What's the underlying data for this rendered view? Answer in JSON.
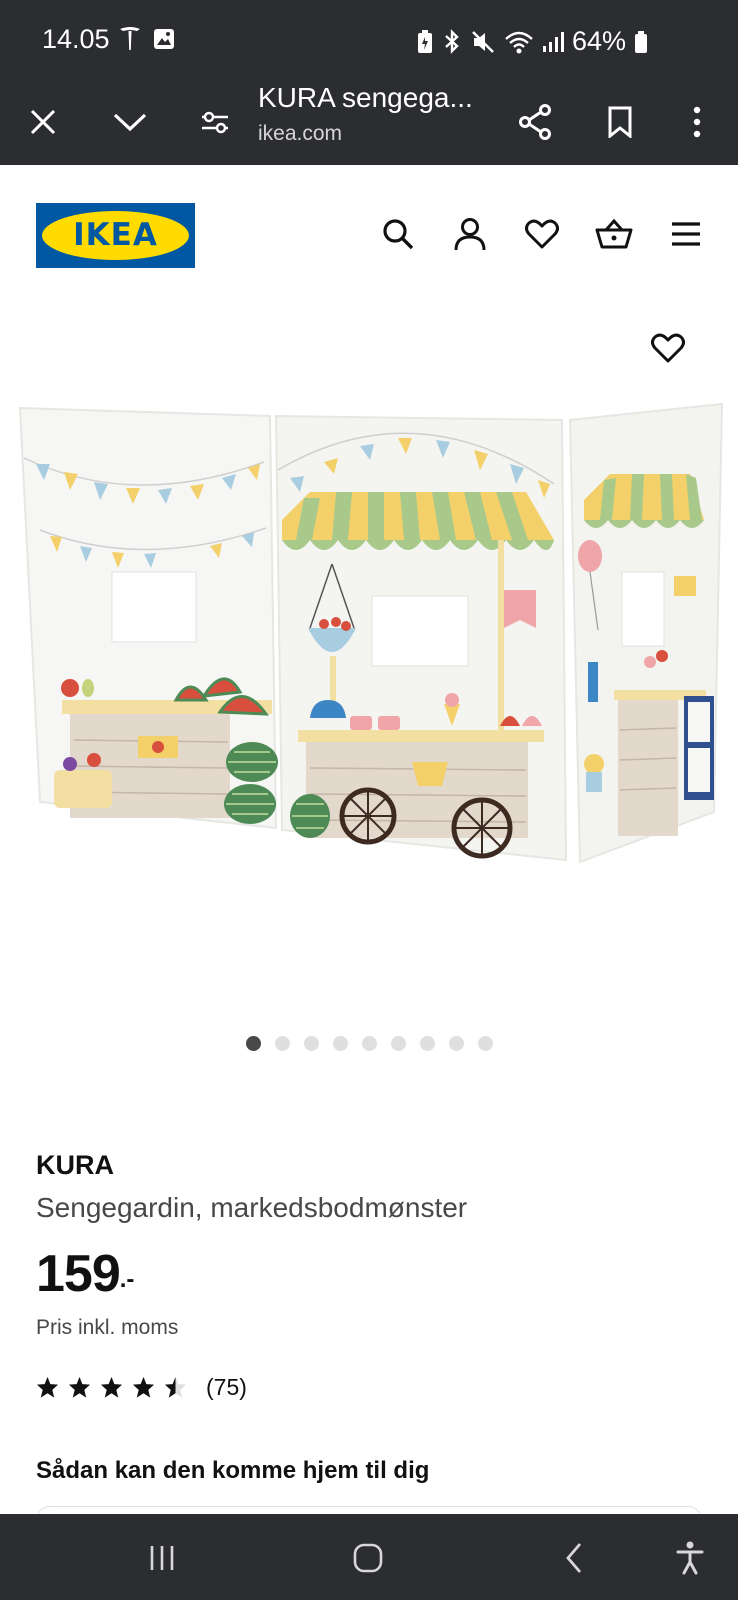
{
  "status_bar": {
    "time": "14.05",
    "battery": "64%",
    "icons": [
      "tesla-icon",
      "image-icon",
      "battery-saver-icon",
      "bluetooth-icon",
      "mute-icon",
      "wifi-icon",
      "signal-icon",
      "battery-icon"
    ]
  },
  "browser": {
    "title": "KURA sengega...",
    "url": "ikea.com",
    "icons": [
      "close-icon",
      "chevron-down-icon",
      "site-settings-icon",
      "share-icon",
      "bookmark-icon",
      "more-icon"
    ]
  },
  "header": {
    "logo_text": "IKEA",
    "icons": [
      "search-icon",
      "account-icon",
      "favourites-icon",
      "basket-icon",
      "menu-icon"
    ]
  },
  "gallery": {
    "image_count": 9,
    "active_index": 0
  },
  "product": {
    "name": "KURA",
    "description": "Sengegardin, markedsbodmønster",
    "price": "159",
    "price_suffix": ".-",
    "vat_note": "Pris inkl. moms",
    "rating": 4.5,
    "rating_max": 5,
    "review_count": "(75)"
  },
  "delivery": {
    "heading": "Sådan kan den komme hjem til dig"
  },
  "colors": {
    "system_bar": "#2b2d31",
    "ikea_blue": "#0058a3",
    "ikea_yellow": "#ffdb00",
    "text": "#111111",
    "muted_text": "#484848"
  }
}
